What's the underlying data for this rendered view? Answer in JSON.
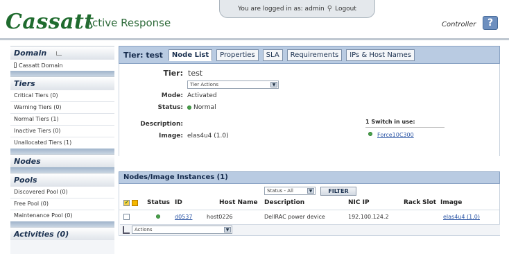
{
  "header": {
    "logo": "Cassatt",
    "product": "Active Response",
    "login_text": "You are logged in as: admin",
    "logout_label": "Logout",
    "controller_label": "Controller",
    "help_label": "?"
  },
  "sidebar": {
    "domain": {
      "title": "Domain",
      "item": "Cassatt Domain"
    },
    "tiers": {
      "title": "Tiers",
      "items": [
        "Critical Tiers (0)",
        "Warning Tiers (0)",
        "Normal Tiers (1)",
        "Inactive Tiers (0)",
        "Unallocated Tiers (1)"
      ]
    },
    "nodes": {
      "title": "Nodes"
    },
    "pools": {
      "title": "Pools",
      "items": [
        "Discovered Pool (0)",
        "Free Pool (0)",
        "Maintenance Pool (0)"
      ]
    },
    "activities": {
      "title": "Activities (0)"
    }
  },
  "main": {
    "title": "Tier: test",
    "tabs": [
      "Node List",
      "Properties",
      "SLA",
      "Requirements",
      "IPs & Host Names"
    ],
    "active_tab": "Node List",
    "props": {
      "tier_label": "Tier:",
      "tier_value": "test",
      "tier_actions": "Tier Actions",
      "mode_label": "Mode:",
      "mode_value": "Activated",
      "status_label": "Status:",
      "status_value": "Normal",
      "description_label": "Description:",
      "image_label": "Image:",
      "image_value": "elas4u4 (1.0)",
      "switch_title": "1 Switch in use:",
      "switch_name": "Force10C300"
    },
    "nodes": {
      "title": "Nodes/Image Instances (1)",
      "status_filter": "Status - All",
      "filter_label": "FILTER",
      "columns": [
        "Status",
        "ID",
        "Host Name",
        "Description",
        "NIC IP",
        "Rack",
        "Slot",
        "Image"
      ],
      "rows": [
        {
          "id": "d0537",
          "host": "host0226",
          "description": "DellRAC power device",
          "nic_ip": "192.100.124.2",
          "rack": "",
          "slot": "",
          "image": "elas4u4 (1.0)"
        }
      ],
      "actions_label": "Actions"
    }
  },
  "colors": {
    "brand_green": "#1f6b2e",
    "status_normal": "#4aa24a",
    "header_band": "#b9cbe2",
    "link": "#2b55a5"
  }
}
